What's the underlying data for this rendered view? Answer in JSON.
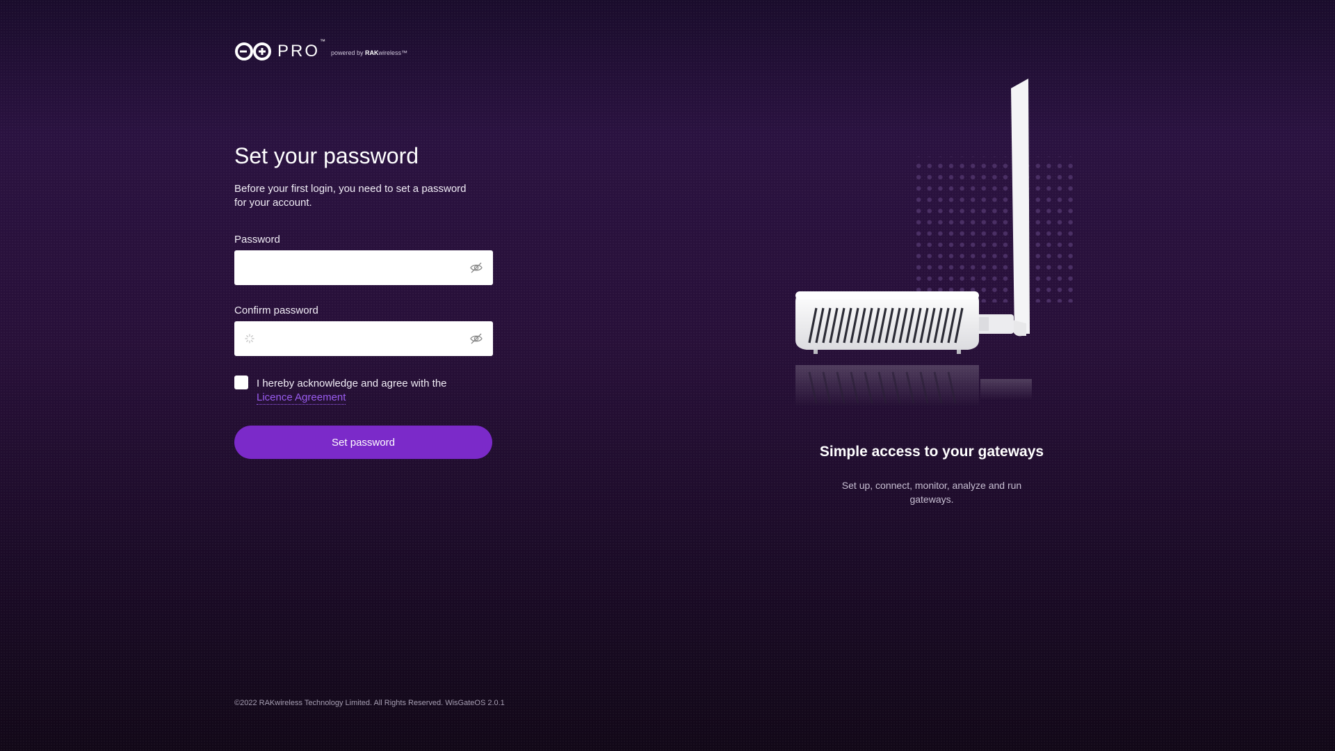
{
  "brand": {
    "product": "PRO",
    "trademark": "™",
    "powered_by_prefix": "powered by ",
    "powered_by_brand": "RAK",
    "powered_by_suffix": "wireless™"
  },
  "form": {
    "title": "Set your password",
    "subtitle": "Before your first login, you need to set a password for your account.",
    "password_label": "Password",
    "password_value": "",
    "confirm_label": "Confirm password",
    "confirm_value": "",
    "agree_text": "I hereby acknowledge and agree with the",
    "licence_link": "Licence Agreement",
    "agree_checked": false,
    "submit_label": "Set password"
  },
  "hero": {
    "title": "Simple access to your gateways",
    "subtitle": "Set up, connect, monitor, analyze and run gateways."
  },
  "footer": {
    "copyright": "©2022 RAKwireless Technology Limited. All Rights Reserved. WisGateOS 2.0.1"
  },
  "colors": {
    "accent": "#7b2ac9",
    "link": "#9a5cf0",
    "background": "#281039"
  },
  "icons": [
    "arduino-infinity-logo",
    "eye-off-icon",
    "eye-off-icon",
    "loading-spinner-icon"
  ]
}
